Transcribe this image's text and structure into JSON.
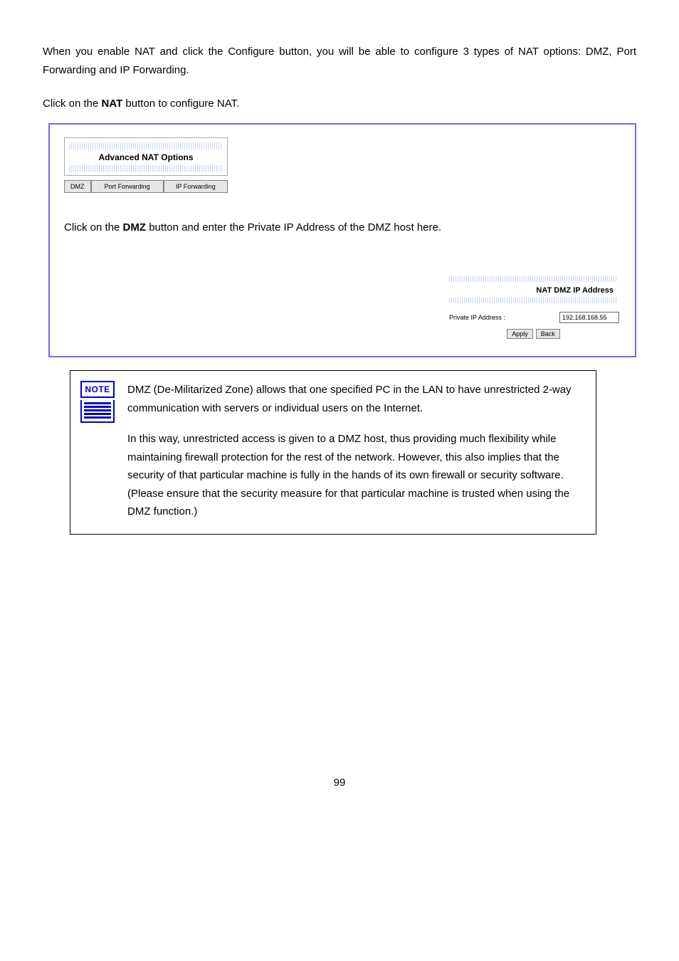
{
  "para1": "When you enable NAT and click the Configure button, you will be able to configure 3 types of NAT options: DMZ, Port Forwarding and IP Forwarding.",
  "step4a": "Click on the ",
  "step4b": "NAT",
  "step4c": " button to configure NAT.",
  "step5a": "Click on the ",
  "step5b": "DMZ",
  "step5c": " button and enter the Private IP Address of the DMZ host here.",
  "nat_options": {
    "title": "Advanced NAT Options",
    "tabs": [
      "DMZ",
      "Port Forwarding",
      "IP Forwarding"
    ]
  },
  "dmz": {
    "title": "NAT DMZ IP Address",
    "label": "Private IP Address :",
    "value": "192.168.168.55",
    "apply": "Apply",
    "back": "Back"
  },
  "note": {
    "label": "NOTE",
    "p1": "DMZ (De-Militarized Zone) allows that one specified PC in the LAN to have unrestricted 2-way communication with servers or individual users on the Internet.",
    "p2": "In this way, unrestricted access is given to a DMZ host, thus providing much flexibility while maintaining firewall protection for the rest of the network. However, this also implies that the security of that particular machine is fully in the hands of its own firewall or security software. (Please ensure that the security measure for that particular machine is trusted when using the DMZ function.)"
  },
  "page_number": "99"
}
